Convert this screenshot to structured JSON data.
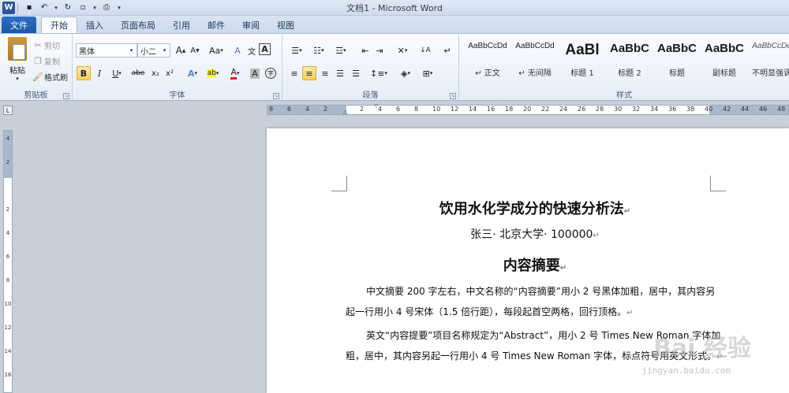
{
  "window": {
    "title": "文档1 - Microsoft Word",
    "quick_access": [
      "word-icon",
      "save-icon",
      "undo-icon",
      "redo-icon",
      "new-doc-icon",
      "print-icon"
    ]
  },
  "tabs": {
    "file": "文件",
    "items": [
      "开始",
      "插入",
      "页面布局",
      "引用",
      "邮件",
      "审阅",
      "视图"
    ],
    "active": 0
  },
  "clipboard": {
    "paste": "粘贴",
    "cut": "剪切",
    "copy": "复制",
    "format_painter": "格式刷",
    "label": "剪贴板"
  },
  "font": {
    "name": "黑体",
    "size": "小二",
    "grow": "A",
    "shrink": "A",
    "case": "Aa",
    "clear": "A",
    "phonetic": "文",
    "bold": "B",
    "italic": "I",
    "underline": "U",
    "strike": "abe",
    "sub": "x₂",
    "sup": "x²",
    "label": "字体"
  },
  "paragraph": {
    "label": "段落"
  },
  "styles": {
    "label": "样式",
    "items": [
      {
        "sample": "AaBbCcDd",
        "name": "↵ 正文",
        "size": "10px",
        "weight": "normal"
      },
      {
        "sample": "AaBbCcDd",
        "name": "↵ 无间隔",
        "size": "10px",
        "weight": "normal"
      },
      {
        "sample": "AaBl",
        "name": "标题 1",
        "size": "19px",
        "weight": "bold"
      },
      {
        "sample": "AaBbC",
        "name": "标题 2",
        "size": "15px",
        "weight": "bold"
      },
      {
        "sample": "AaBbC",
        "name": "标题",
        "size": "15px",
        "weight": "bold"
      },
      {
        "sample": "AaBbC",
        "name": "副标题",
        "size": "15px",
        "weight": "bold"
      },
      {
        "sample": "AaBbCcDe",
        "name": "不明显强调",
        "size": "10px",
        "weight": "normal"
      }
    ]
  },
  "ruler": {
    "numbers": [
      "8",
      "6",
      "4",
      "2",
      "",
      "2",
      "4",
      "6",
      "8",
      "10",
      "12",
      "14",
      "16",
      "18",
      "20",
      "22",
      "24",
      "26",
      "28",
      "30",
      "32",
      "34",
      "36",
      "38",
      "40",
      "42",
      "44",
      "46",
      "48"
    ],
    "vnumbers": [
      "4",
      "2",
      "",
      "2",
      "4",
      "6",
      "8",
      "10",
      "12",
      "14",
      "16"
    ]
  },
  "document": {
    "title": "饮用水化学成分的快速分析法",
    "author": "张三· 北京大学· 100000",
    "heading": "内容摘要",
    "para1": "中文摘要 200 字左右，中文名称的“内容摘要”用小 2 号黑体加粗，居中，其内容另起一行用小 4 号宋体（1.5 倍行距），每段起首空两格，回行顶格。",
    "para2": "英文“内容提要”项目名称规定为“Abstract”，用小 2 号 Times New Roman 字体加粗，居中，其内容另起一行用小 4 号 Times New Roman 字体，标点符号用英文形式。",
    "para_mark": "↵"
  },
  "watermark": {
    "main": "Bai  经验",
    "sub": "jingyan.baidu.com"
  }
}
